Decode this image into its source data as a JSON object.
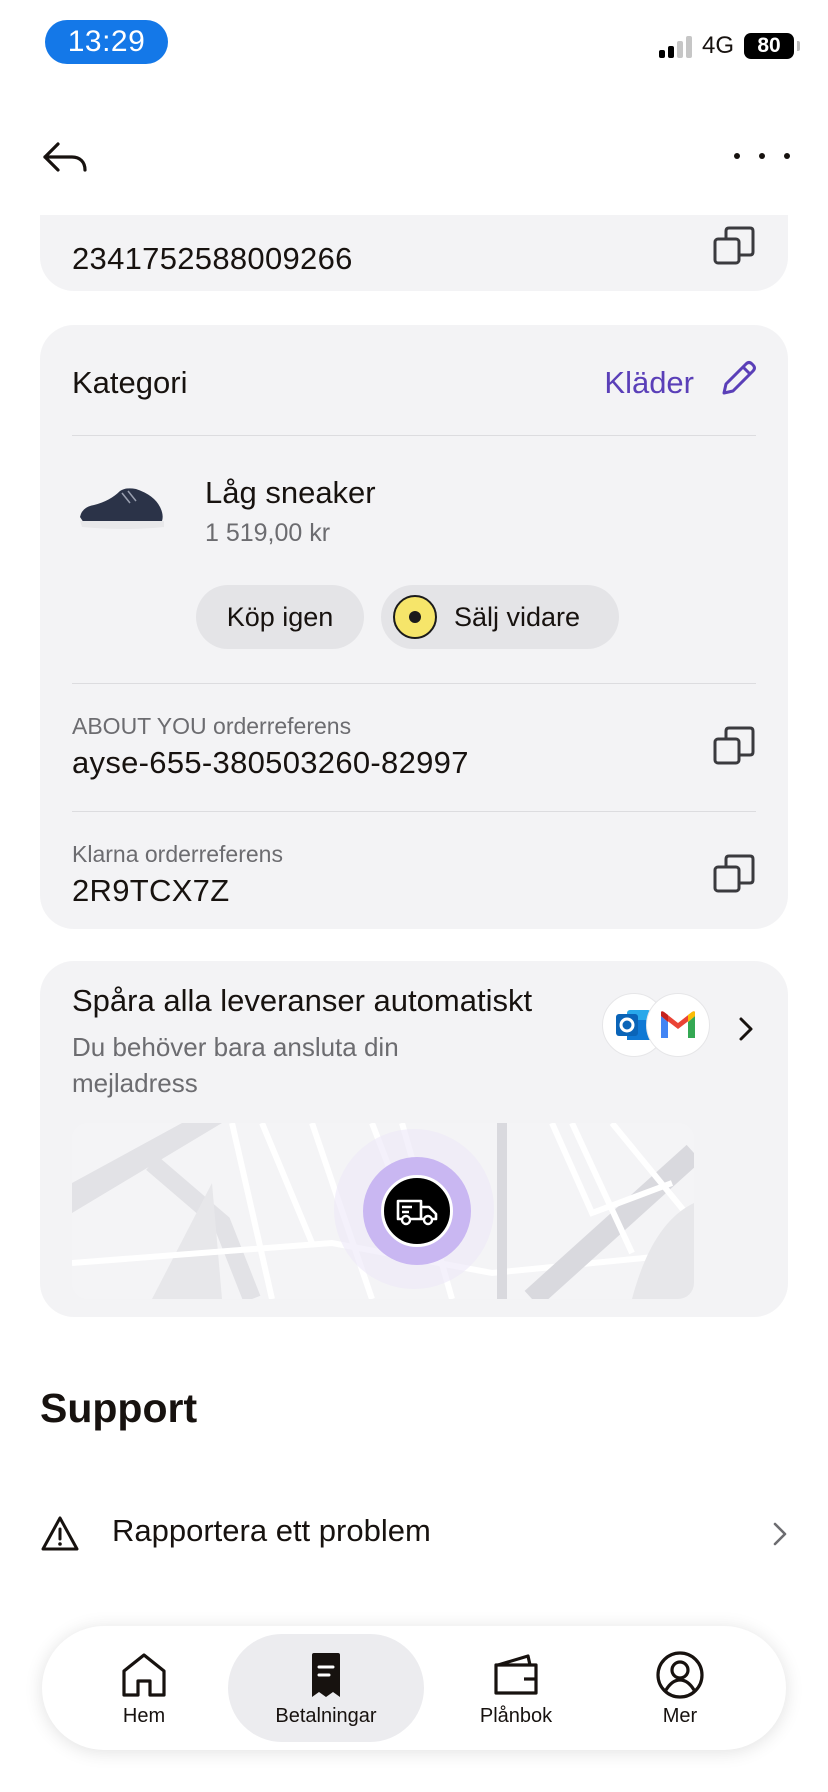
{
  "status_bar": {
    "time": "13:29",
    "network": "4G",
    "battery": "80"
  },
  "top_card": {
    "value": "2341752588009266"
  },
  "category_card": {
    "label": "Kategori",
    "value": "Kläder",
    "product": {
      "name": "Låg sneaker",
      "price": "1 519,00 kr"
    },
    "buy_again_label": "Köp igen",
    "sell_label": "Sälj vidare",
    "refs": [
      {
        "label": "ABOUT YOU orderreferens",
        "value": "ayse-655-380503260-82997"
      },
      {
        "label": "Klarna orderreferens",
        "value": "2R9TCX7Z"
      }
    ]
  },
  "tracking_card": {
    "title": "Spåra alla leveranser automatiskt",
    "subtitle": "Du behöver bara ansluta din mejladress",
    "brand_icons": [
      "outlook-icon",
      "gmail-icon"
    ]
  },
  "support": {
    "title": "Support",
    "report_label": "Rapportera ett problem"
  },
  "tabbar": {
    "tabs": [
      {
        "label": "Hem",
        "icon": "home-icon"
      },
      {
        "label": "Betalningar",
        "icon": "receipt-icon",
        "active": true
      },
      {
        "label": "Plånbok",
        "icon": "wallet-icon"
      },
      {
        "label": "Mer",
        "icon": "profile-icon"
      }
    ]
  },
  "colors": {
    "accent": "#5a3fb8",
    "time_pill": "#1478e8",
    "card_bg": "#f3f3f5"
  }
}
